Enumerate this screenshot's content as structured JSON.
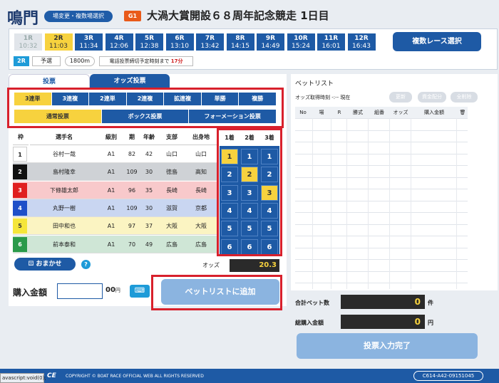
{
  "header": {
    "venue": "鳴門",
    "change_button": "場変更・複数場選択",
    "grade": "G1",
    "race_title": "大渦大賞開設６８周年記念競走 1日目"
  },
  "races": [
    {
      "num": "1R",
      "time": "10:32",
      "state": "done"
    },
    {
      "num": "2R",
      "time": "11:03",
      "state": "selected"
    },
    {
      "num": "3R",
      "time": "11:34",
      "state": "open"
    },
    {
      "num": "4R",
      "time": "12:06",
      "state": "open"
    },
    {
      "num": "5R",
      "time": "12:38",
      "state": "open"
    },
    {
      "num": "6R",
      "time": "13:10",
      "state": "open"
    },
    {
      "num": "7R",
      "time": "13:42",
      "state": "open"
    },
    {
      "num": "8R",
      "time": "14:15",
      "state": "open"
    },
    {
      "num": "9R",
      "time": "14:49",
      "state": "open"
    },
    {
      "num": "10R",
      "time": "15:24",
      "state": "open"
    },
    {
      "num": "11R",
      "time": "16:01",
      "state": "open"
    },
    {
      "num": "12R",
      "time": "16:43",
      "state": "open"
    }
  ],
  "race_info": {
    "multi_race_button": "複数レース選択",
    "selected_race": "2R",
    "stage": "予選",
    "distance": "1800m",
    "deadline_label": "電話投票締切予定時刻まで",
    "deadline_time": "17分"
  },
  "tabs": {
    "vote": "投票",
    "odds": "オッズ投票"
  },
  "bet_types": [
    "3連単",
    "3連複",
    "2連単",
    "2連複",
    "拡連複",
    "単勝",
    "複勝"
  ],
  "bet_modes": [
    "通常投票",
    "ボックス投票",
    "フォーメーション投票"
  ],
  "racer_table": {
    "headers": [
      "枠",
      "選手名",
      "級別",
      "期",
      "年齢",
      "支部",
      "出身地"
    ],
    "rows": [
      {
        "frame": "1",
        "name": "谷村一哉",
        "class": "A1",
        "term": "82",
        "age": "42",
        "branch": "山口",
        "home": "山口"
      },
      {
        "frame": "2",
        "name": "島村隆幸",
        "class": "A1",
        "term": "109",
        "age": "30",
        "branch": "徳島",
        "home": "高知"
      },
      {
        "frame": "3",
        "name": "下條雄太郎",
        "class": "A1",
        "term": "96",
        "age": "35",
        "branch": "長崎",
        "home": "長崎"
      },
      {
        "frame": "4",
        "name": "丸野一樹",
        "class": "A1",
        "term": "109",
        "age": "30",
        "branch": "滋賀",
        "home": "京都"
      },
      {
        "frame": "5",
        "name": "田中和也",
        "class": "A1",
        "term": "97",
        "age": "37",
        "branch": "大阪",
        "home": "大阪"
      },
      {
        "frame": "6",
        "name": "前本泰和",
        "class": "A1",
        "term": "70",
        "age": "49",
        "branch": "広島",
        "home": "広島"
      }
    ]
  },
  "rank_headers": [
    "1着",
    "2着",
    "3着"
  ],
  "rank_selected": [
    1,
    2,
    3
  ],
  "omakase": "おまかせ",
  "help": "?",
  "odds_label": "オッズ",
  "odds_value": "20.3",
  "buy": {
    "label": "購入金額",
    "unit": "00",
    "yen": "円"
  },
  "add_bet_button": "ベットリストに追加",
  "bet_list": {
    "title": "ベットリスト",
    "odds_time": "オッズ取得時刻 -:-- 現在",
    "buttons": [
      "更新",
      "資金配分",
      "全削除"
    ],
    "headers": [
      "No",
      "場",
      "R",
      "勝式",
      "組番",
      "オッズ",
      "購入金額"
    ],
    "total_bets_label": "合計ベット数",
    "total_bets": "0",
    "total_bets_unit": "件",
    "total_amount_label": "総購入金額",
    "total_amount": "0",
    "total_amount_unit": "円",
    "complete_button": "投票入力完了"
  },
  "footer": {
    "status_url": "avascript:void(0);",
    "brand": "CE",
    "copyright": "COPYRIGHT © BOAT RACE OFFICIAL WEB ALL RIGHTS RESERVED",
    "version": "C614-A42-09151045"
  },
  "colors": {
    "accent": "#1e5aa5",
    "selected": "#f7d23e",
    "highlight_box": "#d8202c"
  }
}
